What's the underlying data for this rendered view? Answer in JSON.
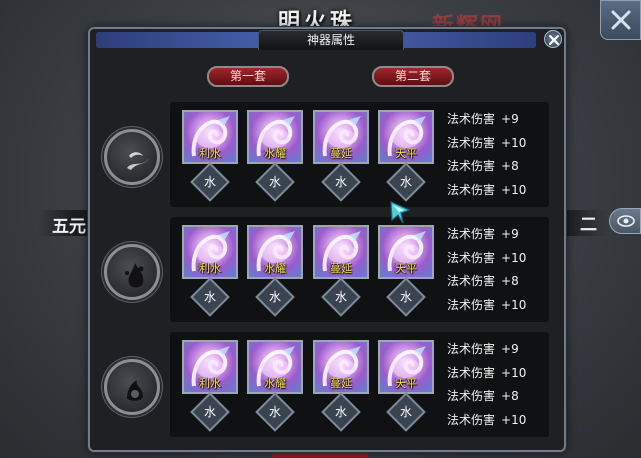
{
  "background": {
    "title": "明火珠",
    "watermark": "新辉网",
    "left_label": "五元",
    "right_label": "二"
  },
  "dialog": {
    "title": "神器属性",
    "set_buttons": [
      "第一套",
      "第二套"
    ],
    "rows": [
      {
        "emblem_icon": "wave-emblem-icon",
        "items": [
          {
            "name": "利水",
            "element": "水"
          },
          {
            "name": "水耀",
            "element": "水"
          },
          {
            "name": "蔓延",
            "element": "水"
          },
          {
            "name": "天平",
            "element": "水"
          }
        ],
        "stats": [
          {
            "label": "法术伤害",
            "value": "+9"
          },
          {
            "label": "法术伤害",
            "value": "+10"
          },
          {
            "label": "法术伤害",
            "value": "+8"
          },
          {
            "label": "法术伤害",
            "value": "+10"
          }
        ]
      },
      {
        "emblem_icon": "drop-emblem-icon",
        "items": [
          {
            "name": "利水",
            "element": "水"
          },
          {
            "name": "水耀",
            "element": "水"
          },
          {
            "name": "蔓延",
            "element": "水"
          },
          {
            "name": "天平",
            "element": "水"
          }
        ],
        "stats": [
          {
            "label": "法术伤害",
            "value": "+9"
          },
          {
            "label": "法术伤害",
            "value": "+10"
          },
          {
            "label": "法术伤害",
            "value": "+8"
          },
          {
            "label": "法术伤害",
            "value": "+10"
          }
        ]
      },
      {
        "emblem_icon": "flame-emblem-icon",
        "items": [
          {
            "name": "利水",
            "element": "水"
          },
          {
            "name": "水耀",
            "element": "水"
          },
          {
            "name": "蔓延",
            "element": "水"
          },
          {
            "name": "天平",
            "element": "水"
          }
        ],
        "stats": [
          {
            "label": "法术伤害",
            "value": "+9"
          },
          {
            "label": "法术伤害",
            "value": "+10"
          },
          {
            "label": "法术伤害",
            "value": "+8"
          },
          {
            "label": "法术伤害",
            "value": "+10"
          }
        ]
      }
    ]
  },
  "colors": {
    "item_name": "#f4e23a",
    "button_red": "#a0262c",
    "title_bar_blue": "#4b67b5"
  }
}
